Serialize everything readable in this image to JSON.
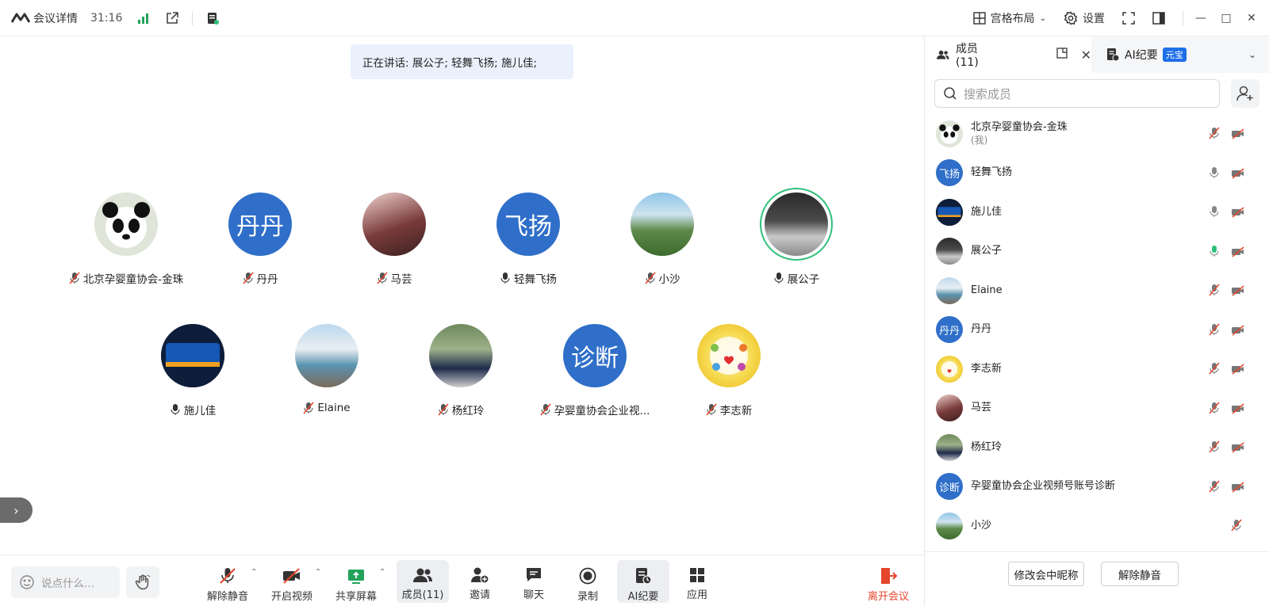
{
  "titlebar": {
    "meeting_info": "会议详情",
    "timer": "31:16",
    "layout_label": "宫格布局",
    "settings_label": "设置"
  },
  "speaking": "正在讲话: 展公子; 轻舞飞扬; 施儿佳;",
  "tiles": [
    {
      "name": "北京孕婴童协会-金珠",
      "avatar_text": "",
      "muted": true
    },
    {
      "name": "丹丹",
      "avatar_text": "丹丹",
      "muted": true
    },
    {
      "name": "马芸",
      "avatar_text": "",
      "muted": true
    },
    {
      "name": "轻舞飞扬",
      "avatar_text": "飞扬",
      "muted": false
    },
    {
      "name": "小沙",
      "avatar_text": "",
      "muted": true
    },
    {
      "name": "展公子",
      "avatar_text": "",
      "muted": false
    },
    {
      "name": "施儿佳",
      "avatar_text": "",
      "muted": false
    },
    {
      "name": "Elaine",
      "avatar_text": "",
      "muted": true
    },
    {
      "name": "杨红玲",
      "avatar_text": "",
      "muted": true
    },
    {
      "name": "孕婴童协会企业视...",
      "avatar_text": "诊断",
      "muted": true
    },
    {
      "name": "李志新",
      "avatar_text": "",
      "muted": true
    }
  ],
  "toolbar": {
    "chat_placeholder": "说点什么...",
    "items": [
      "解除静音",
      "开启视频",
      "共享屏幕",
      "成员(11)",
      "邀请",
      "聊天",
      "录制",
      "AI纪要",
      "应用"
    ],
    "leave": "离开会议"
  },
  "panel": {
    "members_tab": "成员(11)",
    "ai_tab": "AI纪要",
    "ai_badge": "元宝",
    "search_placeholder": "搜索成员",
    "members": [
      {
        "name": "北京孕婴童协会-金珠",
        "sub": "(我)",
        "avatar_text": ""
      },
      {
        "name": "轻舞飞扬",
        "sub": "",
        "avatar_text": "飞扬"
      },
      {
        "name": "施儿佳",
        "sub": "",
        "avatar_text": ""
      },
      {
        "name": "展公子",
        "sub": "",
        "avatar_text": ""
      },
      {
        "name": "Elaine",
        "sub": "",
        "avatar_text": ""
      },
      {
        "name": "丹丹",
        "sub": "",
        "avatar_text": "丹丹"
      },
      {
        "name": "李志新",
        "sub": "",
        "avatar_text": ""
      },
      {
        "name": "马芸",
        "sub": "",
        "avatar_text": ""
      },
      {
        "name": "杨红玲",
        "sub": "",
        "avatar_text": ""
      },
      {
        "name": "孕婴童协会企业视频号账号诊断",
        "sub": "",
        "avatar_text": "诊断"
      },
      {
        "name": "小沙",
        "sub": "",
        "avatar_text": ""
      }
    ],
    "rename_button": "修改会中昵称",
    "unmute_all_button": "解除静音"
  },
  "colors": {
    "accent_blue": "#2f6fc9",
    "active_speaker": "#2fc07a",
    "leave_red": "#e5462c",
    "share_green": "#22a35a"
  }
}
